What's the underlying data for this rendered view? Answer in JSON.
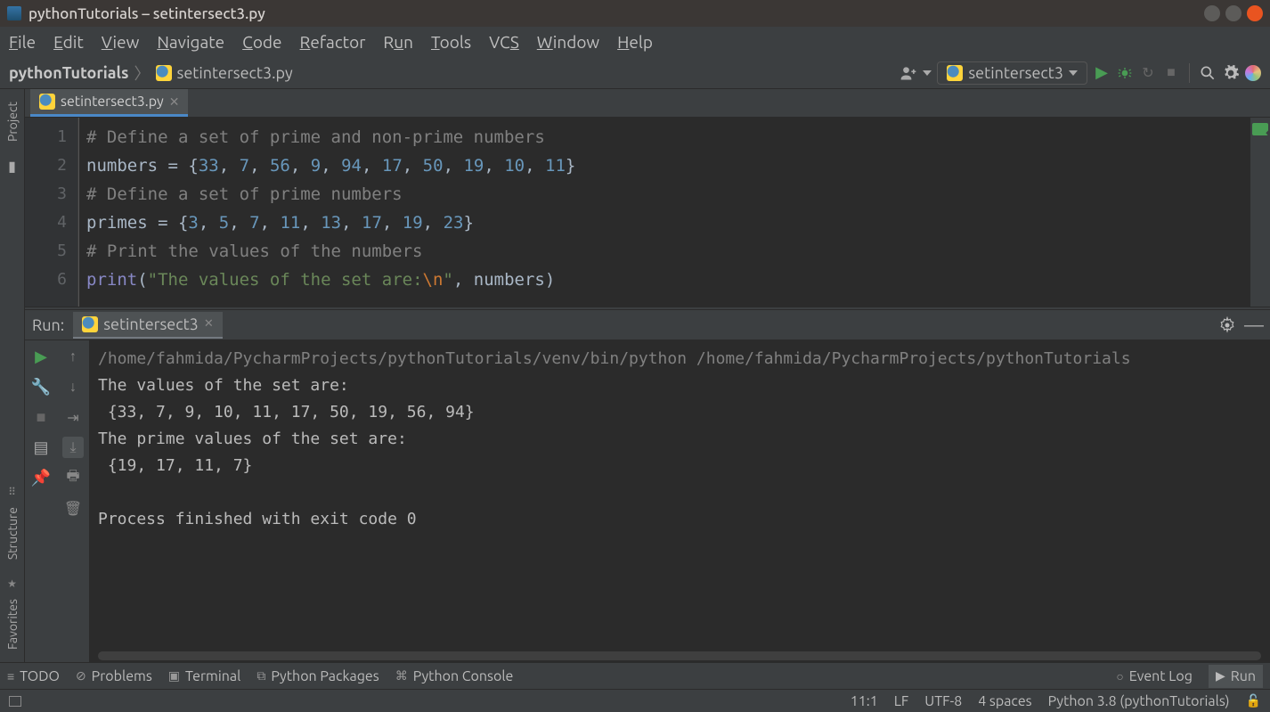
{
  "window": {
    "title": "pythonTutorials – setintersect3.py"
  },
  "menu": {
    "file": "File",
    "edit": "Edit",
    "view": "View",
    "navigate": "Navigate",
    "code": "Code",
    "refactor": "Refactor",
    "run": "Run",
    "tools": "Tools",
    "vcs": "VCS",
    "window": "Window",
    "help": "Help"
  },
  "breadcrumb": {
    "project": "pythonTutorials",
    "file": "setintersect3.py"
  },
  "run_config": {
    "name": "setintersect3"
  },
  "editor_tab": {
    "label": "setintersect3.py"
  },
  "code": {
    "line1": "# Define a set of prime and non-prime numbers",
    "l2_a": "numbers ",
    "l2_eq": "=",
    "l2_ob": " {",
    "l2_cb": "}",
    "l2_n": [
      "33",
      "7",
      "56",
      "9",
      "94",
      "17",
      "50",
      "19",
      "10",
      "11"
    ],
    "line3": "# Define a set of prime numbers",
    "l4_a": "primes ",
    "l4_n": [
      "3",
      "5",
      "7",
      "11",
      "13",
      "17",
      "19",
      "23"
    ],
    "line5": "# Print the values of the numbers",
    "l6_fn": "print",
    "l6_op": "(",
    "l6_s1": "\"The values of the set are:",
    "l6_esc": "\\n",
    "l6_s2": "\"",
    "l6_cm": ", ",
    "l6_id": "numbers",
    "l6_cp": ")"
  },
  "gutter": {
    "1": "1",
    "2": "2",
    "3": "3",
    "4": "4",
    "5": "5",
    "6": "6"
  },
  "left": {
    "project": "Project",
    "structure": "Structure",
    "favorites": "Favorites"
  },
  "run_panel": {
    "title": "Run:",
    "tab": "setintersect3"
  },
  "console": {
    "l1": "/home/fahmida/PycharmProjects/pythonTutorials/venv/bin/python /home/fahmida/PycharmProjects/pythonTutorials",
    "l2": "The values of the set are:",
    "l3": " {33, 7, 9, 10, 11, 17, 50, 19, 56, 94}",
    "l4": "The prime values of the set are:",
    "l5": " {19, 17, 11, 7}",
    "l6": "",
    "l7": "Process finished with exit code 0"
  },
  "bottom": {
    "todo": "TODO",
    "problems": "Problems",
    "terminal": "Terminal",
    "pypkg": "Python Packages",
    "pycon": "Python Console",
    "eventlog": "Event Log",
    "run": "Run"
  },
  "status": {
    "pos": "11:1",
    "lf": "LF",
    "enc": "UTF-8",
    "indent": "4 spaces",
    "interp": "Python 3.8 (pythonTutorials)"
  }
}
